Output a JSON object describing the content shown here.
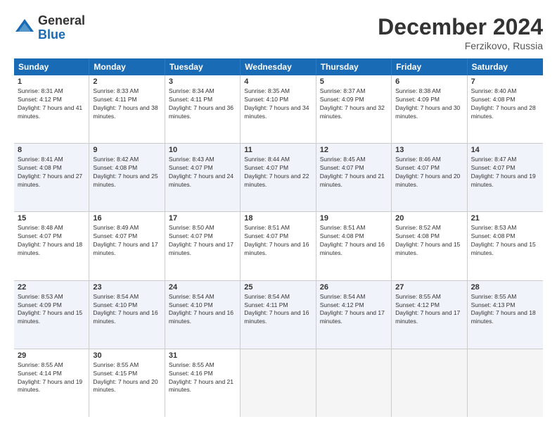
{
  "header": {
    "logo_general": "General",
    "logo_blue": "Blue",
    "month_title": "December 2024",
    "location": "Ferzikovo, Russia"
  },
  "days_of_week": [
    "Sunday",
    "Monday",
    "Tuesday",
    "Wednesday",
    "Thursday",
    "Friday",
    "Saturday"
  ],
  "weeks": [
    [
      {
        "day": "1",
        "sunrise": "8:31 AM",
        "sunset": "4:12 PM",
        "daylight": "7 hours and 41 minutes."
      },
      {
        "day": "2",
        "sunrise": "8:33 AM",
        "sunset": "4:11 PM",
        "daylight": "7 hours and 38 minutes."
      },
      {
        "day": "3",
        "sunrise": "8:34 AM",
        "sunset": "4:11 PM",
        "daylight": "7 hours and 36 minutes."
      },
      {
        "day": "4",
        "sunrise": "8:35 AM",
        "sunset": "4:10 PM",
        "daylight": "7 hours and 34 minutes."
      },
      {
        "day": "5",
        "sunrise": "8:37 AM",
        "sunset": "4:09 PM",
        "daylight": "7 hours and 32 minutes."
      },
      {
        "day": "6",
        "sunrise": "8:38 AM",
        "sunset": "4:09 PM",
        "daylight": "7 hours and 30 minutes."
      },
      {
        "day": "7",
        "sunrise": "8:40 AM",
        "sunset": "4:08 PM",
        "daylight": "7 hours and 28 minutes."
      }
    ],
    [
      {
        "day": "8",
        "sunrise": "8:41 AM",
        "sunset": "4:08 PM",
        "daylight": "7 hours and 27 minutes."
      },
      {
        "day": "9",
        "sunrise": "8:42 AM",
        "sunset": "4:08 PM",
        "daylight": "7 hours and 25 minutes."
      },
      {
        "day": "10",
        "sunrise": "8:43 AM",
        "sunset": "4:07 PM",
        "daylight": "7 hours and 24 minutes."
      },
      {
        "day": "11",
        "sunrise": "8:44 AM",
        "sunset": "4:07 PM",
        "daylight": "7 hours and 22 minutes."
      },
      {
        "day": "12",
        "sunrise": "8:45 AM",
        "sunset": "4:07 PM",
        "daylight": "7 hours and 21 minutes."
      },
      {
        "day": "13",
        "sunrise": "8:46 AM",
        "sunset": "4:07 PM",
        "daylight": "7 hours and 20 minutes."
      },
      {
        "day": "14",
        "sunrise": "8:47 AM",
        "sunset": "4:07 PM",
        "daylight": "7 hours and 19 minutes."
      }
    ],
    [
      {
        "day": "15",
        "sunrise": "8:48 AM",
        "sunset": "4:07 PM",
        "daylight": "7 hours and 18 minutes."
      },
      {
        "day": "16",
        "sunrise": "8:49 AM",
        "sunset": "4:07 PM",
        "daylight": "7 hours and 17 minutes."
      },
      {
        "day": "17",
        "sunrise": "8:50 AM",
        "sunset": "4:07 PM",
        "daylight": "7 hours and 17 minutes."
      },
      {
        "day": "18",
        "sunrise": "8:51 AM",
        "sunset": "4:07 PM",
        "daylight": "7 hours and 16 minutes."
      },
      {
        "day": "19",
        "sunrise": "8:51 AM",
        "sunset": "4:08 PM",
        "daylight": "7 hours and 16 minutes."
      },
      {
        "day": "20",
        "sunrise": "8:52 AM",
        "sunset": "4:08 PM",
        "daylight": "7 hours and 15 minutes."
      },
      {
        "day": "21",
        "sunrise": "8:53 AM",
        "sunset": "4:08 PM",
        "daylight": "7 hours and 15 minutes."
      }
    ],
    [
      {
        "day": "22",
        "sunrise": "8:53 AM",
        "sunset": "4:09 PM",
        "daylight": "7 hours and 15 minutes."
      },
      {
        "day": "23",
        "sunrise": "8:54 AM",
        "sunset": "4:10 PM",
        "daylight": "7 hours and 16 minutes."
      },
      {
        "day": "24",
        "sunrise": "8:54 AM",
        "sunset": "4:10 PM",
        "daylight": "7 hours and 16 minutes."
      },
      {
        "day": "25",
        "sunrise": "8:54 AM",
        "sunset": "4:11 PM",
        "daylight": "7 hours and 16 minutes."
      },
      {
        "day": "26",
        "sunrise": "8:54 AM",
        "sunset": "4:12 PM",
        "daylight": "7 hours and 17 minutes."
      },
      {
        "day": "27",
        "sunrise": "8:55 AM",
        "sunset": "4:12 PM",
        "daylight": "7 hours and 17 minutes."
      },
      {
        "day": "28",
        "sunrise": "8:55 AM",
        "sunset": "4:13 PM",
        "daylight": "7 hours and 18 minutes."
      }
    ],
    [
      {
        "day": "29",
        "sunrise": "8:55 AM",
        "sunset": "4:14 PM",
        "daylight": "7 hours and 19 minutes."
      },
      {
        "day": "30",
        "sunrise": "8:55 AM",
        "sunset": "4:15 PM",
        "daylight": "7 hours and 20 minutes."
      },
      {
        "day": "31",
        "sunrise": "8:55 AM",
        "sunset": "4:16 PM",
        "daylight": "7 hours and 21 minutes."
      },
      null,
      null,
      null,
      null
    ]
  ]
}
